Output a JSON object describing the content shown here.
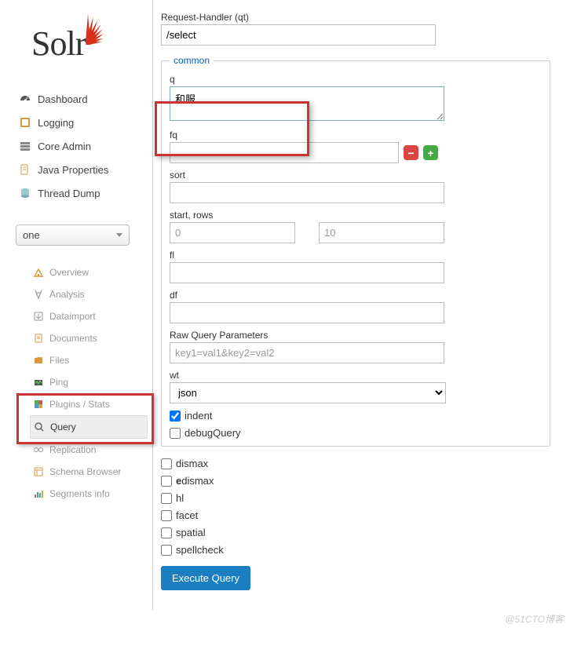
{
  "logo": {
    "text": "Solr"
  },
  "nav": [
    {
      "label": "Dashboard",
      "icon": "dashboard"
    },
    {
      "label": "Logging",
      "icon": "logging"
    },
    {
      "label": "Core Admin",
      "icon": "coreadmin"
    },
    {
      "label": "Java Properties",
      "icon": "java"
    },
    {
      "label": "Thread Dump",
      "icon": "thread"
    }
  ],
  "core_selector": {
    "value": "one"
  },
  "core_nav": [
    {
      "label": "Overview",
      "icon": "overview"
    },
    {
      "label": "Analysis",
      "icon": "analysis"
    },
    {
      "label": "Dataimport",
      "icon": "dataimport"
    },
    {
      "label": "Documents",
      "icon": "documents"
    },
    {
      "label": "Files",
      "icon": "files"
    },
    {
      "label": "Ping",
      "icon": "ping"
    },
    {
      "label": "Plugins / Stats",
      "icon": "plugins"
    },
    {
      "label": "Query",
      "icon": "query",
      "active": true
    },
    {
      "label": "Replication",
      "icon": "replication"
    },
    {
      "label": "Schema Browser",
      "icon": "schema"
    },
    {
      "label": "Segments info",
      "icon": "segments"
    }
  ],
  "form": {
    "qt_label": "Request-Handler (qt)",
    "qt_value": "/select",
    "common_legend": "common",
    "q_label": "q",
    "q_value": "和服",
    "fq_label": "fq",
    "fq_value": "",
    "sort_label": "sort",
    "sort_value": "",
    "startrows_label": "start, rows",
    "start_placeholder": "0",
    "rows_placeholder": "10",
    "fl_label": "fl",
    "fl_value": "",
    "df_label": "df",
    "df_value": "",
    "rawq_label": "Raw Query Parameters",
    "rawq_placeholder": "key1=val1&key2=val2",
    "wt_label": "wt",
    "wt_value": "json",
    "indent_label": "indent",
    "debug_label": "debugQuery",
    "checkboxes": [
      {
        "key": "dismax",
        "label": "dismax",
        "bold": false
      },
      {
        "key": "edismax",
        "first": "e",
        "rest": "dismax"
      },
      {
        "key": "hl",
        "label": "hl"
      },
      {
        "key": "facet",
        "label": "facet"
      },
      {
        "key": "spatial",
        "label": "spatial"
      },
      {
        "key": "spellcheck",
        "label": "spellcheck"
      }
    ],
    "execute_label": "Execute Query"
  },
  "watermark": "@51CTO博客"
}
